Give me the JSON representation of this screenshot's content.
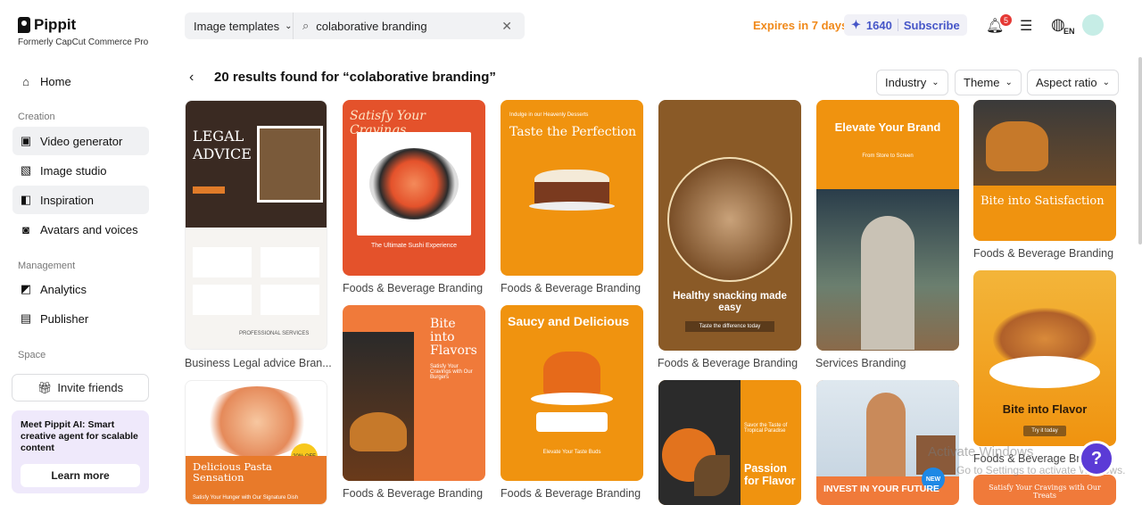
{
  "brand": {
    "name": "Pippit",
    "subtitle": "Formerly CapCut Commerce Pro"
  },
  "sidebar": {
    "home": "Home",
    "creation_label": "Creation",
    "video_generator": "Video generator",
    "image_studio": "Image studio",
    "inspiration": "Inspiration",
    "avatars": "Avatars and voices",
    "management_label": "Management",
    "analytics": "Analytics",
    "publisher": "Publisher",
    "space_label": "Space",
    "invite": "Invite friends",
    "promo_text": "Meet Pippit AI: Smart creative agent for scalable content",
    "learn_more": "Learn more"
  },
  "topbar": {
    "type": "Image templates",
    "search_value": "colaborative branding",
    "expires": "Expires in 7 days",
    "credits": "1640",
    "subscribe": "Subscribe",
    "notifications": "5",
    "lang": "EN"
  },
  "results": {
    "title": "20 results found for “colaborative branding”",
    "filters": [
      "Industry",
      "Theme",
      "Aspect ratio"
    ]
  },
  "cards": [
    {
      "label": "Business Legal advice Bran...",
      "art_title": "LEGAL ADVICE",
      "art_sub": "PROFESSIONAL SERVICES"
    },
    {
      "label": "Foods & Beverage Branding",
      "art_title": "Satisfy Your Cravings",
      "art_sub": "The Ultimate Sushi Experience"
    },
    {
      "label": "Foods & Beverage Branding",
      "art_title": "Taste the Perfection",
      "art_sub": "Indulge in our Heavenly Desserts"
    },
    {
      "label": "Foods & Beverage Branding",
      "art_title": "Healthy snacking made easy",
      "art_sub": "Taste the difference today"
    },
    {
      "label": "Services Branding",
      "art_title": "Elevate Your Brand",
      "art_sub": "From Store to Screen"
    },
    {
      "label": "Foods & Beverage Branding",
      "art_title": "Bite into Satisfaction",
      "art_sub": ""
    },
    {
      "label": "",
      "art_title": "Delicious Pasta Sensation",
      "art_sub": "Satisfy Your Hunger with Our Signature Dish",
      "badge": "20% OFF"
    },
    {
      "label": "Foods & Beverage Branding",
      "art_title": "Bite into Flavors",
      "art_sub": "Satisfy Your Cravings with Our Burgers"
    },
    {
      "label": "Foods & Beverage Branding",
      "art_title": "Saucy and Delicious",
      "art_sub": "Elevate Your Taste Buds"
    },
    {
      "label": "",
      "art_title": "Passion for Flavor",
      "art_sub": "Savor the Taste of Tropical Paradise"
    },
    {
      "label": "",
      "art_title": "INVEST IN YOUR FUTURE",
      "art_sub": "NEW"
    },
    {
      "label": "Foods & Beverage Bra",
      "art_title": "Bite into Flavor",
      "art_sub": "Try it today"
    },
    {
      "label": "",
      "art_title": "Satisfy Your Cravings with Our Treats",
      "art_sub": ""
    }
  ],
  "watermark": {
    "line1": "Activate Windows",
    "line2": "Go to Settings to activate Windows."
  }
}
